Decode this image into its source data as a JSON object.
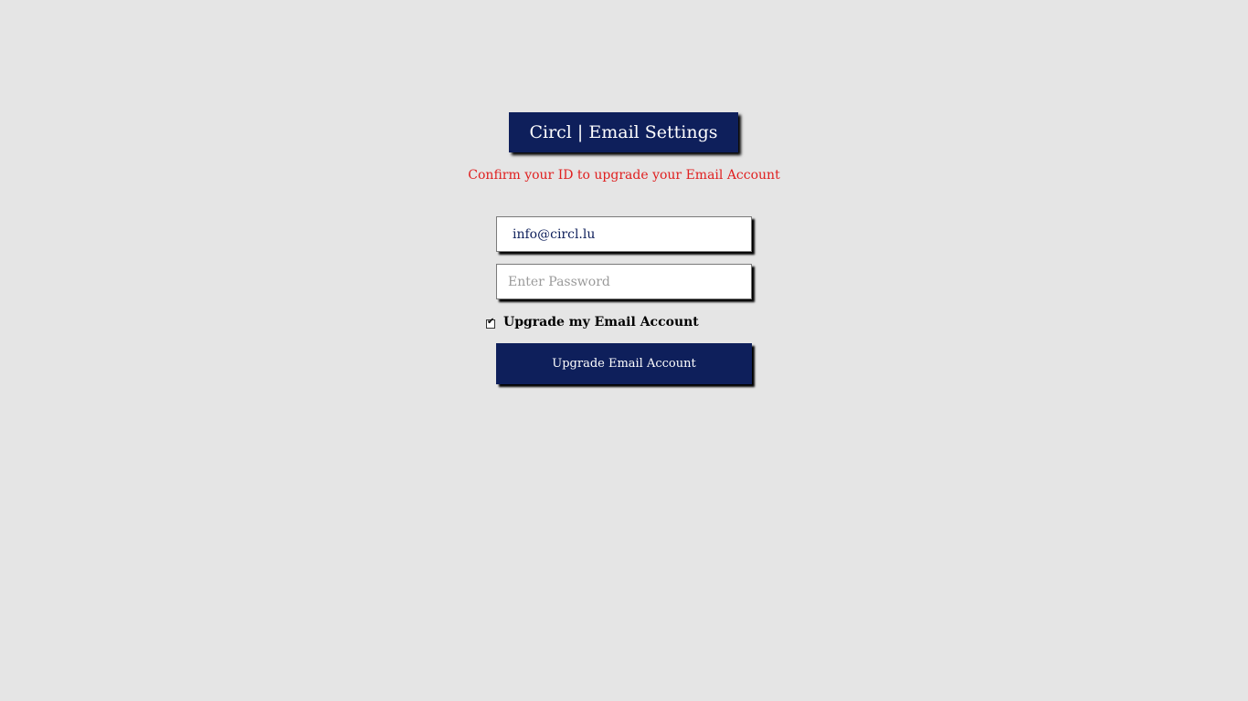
{
  "header": {
    "title": "Circl | Email Settings",
    "subtitle": "Confirm your ID to upgrade your Email Account"
  },
  "form": {
    "email_value": "info@circl.lu",
    "password_placeholder": "Enter Password",
    "checkbox_label": "Upgrade my Email Account",
    "checkbox_checked": true,
    "submit_label": "Upgrade Email Account"
  },
  "colors": {
    "background": "#e5e5e5",
    "brand_navy": "#0e1f5b",
    "warning_red": "#e02020"
  }
}
